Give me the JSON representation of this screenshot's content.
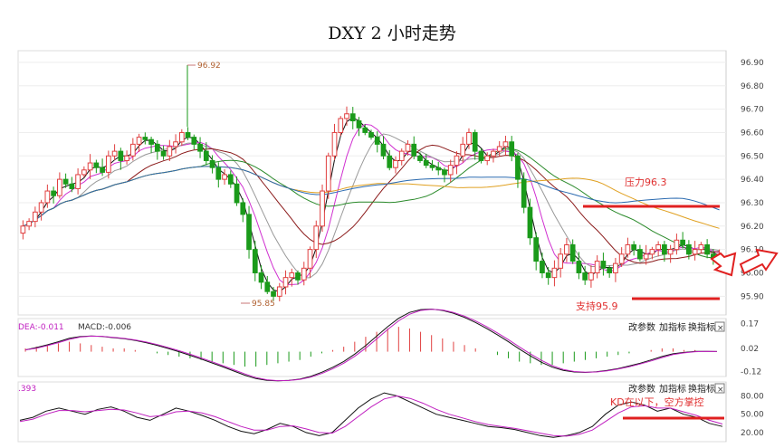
{
  "title": "DXY 2 小时走势",
  "chart_data": {
    "type": "candlestick",
    "title": "DXY 2 小时走势",
    "ylim": [
      95.82,
      96.95
    ],
    "y_ticks": [
      "96.90",
      "96.80",
      "96.70",
      "96.60",
      "96.50",
      "96.40",
      "96.30",
      "96.20",
      "96.10",
      "96.00",
      "95.90"
    ],
    "high_marker": "96.92",
    "low_marker": "95.85",
    "annotations": {
      "resistance_label": "压力96.3",
      "resistance_value": 96.3,
      "support_label": "支持95.9",
      "support_value": 95.9,
      "kd_note": "KD在以下，空方掌控"
    },
    "close_path": [
      96.2,
      96.22,
      96.26,
      96.3,
      96.35,
      96.33,
      96.4,
      96.38,
      96.36,
      96.42,
      96.44,
      96.47,
      96.45,
      96.43,
      96.5,
      96.52,
      96.48,
      96.5,
      96.55,
      96.58,
      96.57,
      96.55,
      96.52,
      96.5,
      96.54,
      96.56,
      96.6,
      96.58,
      96.55,
      96.52,
      96.48,
      96.45,
      96.4,
      96.42,
      96.38,
      96.3,
      96.25,
      96.1,
      96.0,
      95.96,
      95.92,
      95.9,
      95.94,
      95.98,
      96.0,
      95.97,
      96.02,
      96.1,
      96.2,
      96.35,
      96.5,
      96.6,
      96.66,
      96.68,
      96.65,
      96.62,
      96.6,
      96.58,
      96.55,
      96.5,
      96.45,
      96.48,
      96.52,
      96.55,
      96.5,
      96.48,
      96.46,
      96.45,
      96.44,
      96.42,
      96.46,
      96.5,
      96.55,
      96.6,
      96.52,
      96.48,
      96.5,
      96.52,
      96.54,
      96.56,
      96.5,
      96.4,
      96.28,
      96.15,
      96.05,
      96.0,
      95.98,
      96.02,
      96.08,
      96.12,
      96.05,
      96.0,
      95.97,
      96.0,
      96.05,
      96.02,
      96.0,
      96.04,
      96.08,
      96.12,
      96.1,
      96.06,
      96.08,
      96.1,
      96.12,
      96.08,
      96.1,
      96.14,
      96.12,
      96.08,
      96.1,
      96.12,
      96.08,
      96.06,
      96.08
    ],
    "macd_panel": {
      "labels": [
        "DEA:-0.011",
        "MACD:-0.006"
      ],
      "y_ticks": [
        "0.17",
        "0.02",
        "-0.12"
      ],
      "hist": [
        0.02,
        0.03,
        0.04,
        0.05,
        0.06,
        0.05,
        0.04,
        0.03,
        0.02,
        0.02,
        0.01,
        0.0,
        -0.01,
        -0.02,
        -0.03,
        -0.04,
        -0.05,
        -0.06,
        -0.07,
        -0.08,
        -0.09,
        -0.09,
        -0.08,
        -0.07,
        -0.06,
        -0.05,
        -0.03,
        -0.01,
        0.01,
        0.03,
        0.06,
        0.09,
        0.12,
        0.14,
        0.15,
        0.14,
        0.12,
        0.1,
        0.08,
        0.06,
        0.04,
        0.02,
        0.0,
        -0.02,
        -0.04,
        -0.06,
        -0.07,
        -0.08,
        -0.08,
        -0.07,
        -0.06,
        -0.05,
        -0.04,
        -0.03,
        -0.02,
        -0.01,
        0.0,
        0.01,
        0.02,
        0.02,
        0.01,
        0.01,
        0.0,
        0.0
      ]
    },
    "kd_panel": {
      "label": ".393",
      "y_ticks": [
        "80.00",
        "50.00",
        "20.00"
      ],
      "k": [
        40,
        45,
        55,
        60,
        55,
        50,
        58,
        62,
        55,
        45,
        40,
        50,
        60,
        55,
        48,
        40,
        30,
        22,
        18,
        25,
        35,
        30,
        20,
        15,
        20,
        40,
        60,
        75,
        85,
        80,
        70,
        60,
        50,
        45,
        40,
        35,
        30,
        28,
        25,
        20,
        15,
        12,
        15,
        20,
        30,
        50,
        65,
        70,
        65,
        55,
        60,
        50,
        45,
        35,
        30
      ],
      "d": [
        38,
        42,
        50,
        56,
        56,
        54,
        56,
        58,
        57,
        52,
        46,
        48,
        54,
        55,
        52,
        46,
        38,
        30,
        24,
        24,
        30,
        31,
        26,
        20,
        19,
        30,
        46,
        62,
        75,
        80,
        76,
        68,
        58,
        50,
        44,
        38,
        33,
        30,
        27,
        23,
        19,
        15,
        14,
        17,
        24,
        38,
        52,
        62,
        64,
        60,
        60,
        54,
        48,
        40,
        34
      ]
    }
  },
  "controls": {
    "macd": [
      "改参数",
      "加指标",
      "换指标"
    ],
    "kd": [
      "改参数",
      "加指标",
      "换指标"
    ],
    "close": "×"
  },
  "colors": {
    "resistance": "#e02020",
    "support": "#e02020",
    "up": "#e04040",
    "down": "#1a9a1a",
    "arrow": "#e02020"
  }
}
